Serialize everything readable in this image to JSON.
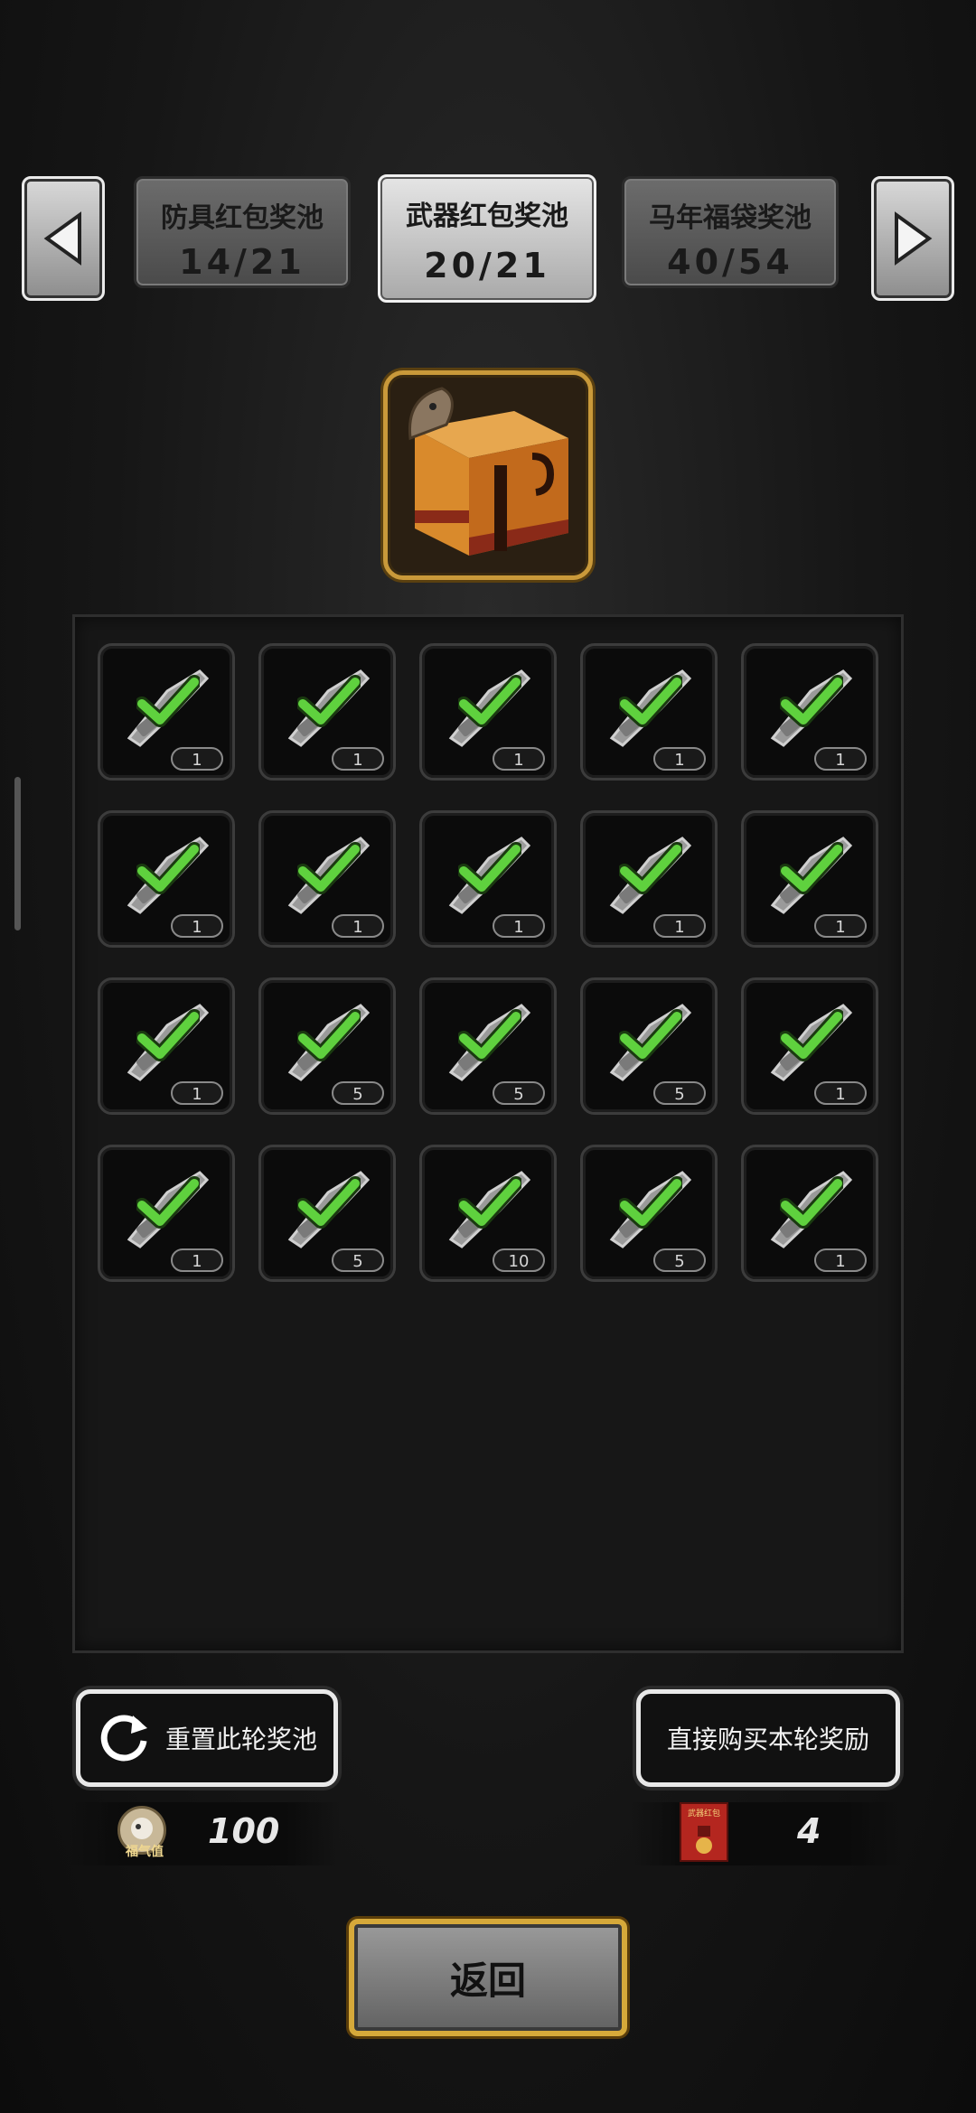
{
  "tabs": [
    {
      "label": "防具红包奖池",
      "progress": "14/21",
      "active": false
    },
    {
      "label": "武器红包奖池",
      "progress": "20/21",
      "active": true
    },
    {
      "label": "马年福袋奖池",
      "progress": "40/54",
      "active": false
    }
  ],
  "grid": [
    {
      "icon": "chainsaw-icon",
      "count": "1",
      "claimed": true
    },
    {
      "icon": "minigun-icon",
      "count": "1",
      "claimed": true
    },
    {
      "icon": "shotgun-icon",
      "count": "1",
      "claimed": true
    },
    {
      "icon": "assault-rifle-icon",
      "count": "1",
      "claimed": true
    },
    {
      "icon": "machete-icon",
      "count": "1",
      "claimed": true
    },
    {
      "icon": "knife-icon",
      "count": "1",
      "claimed": true
    },
    {
      "icon": "rifle-icon",
      "count": "1",
      "claimed": true
    },
    {
      "icon": "flamethrower-icon",
      "count": "1",
      "claimed": true
    },
    {
      "icon": "pipe-wrench-icon",
      "count": "1",
      "claimed": true
    },
    {
      "icon": "shovel-icon",
      "count": "1",
      "claimed": true
    },
    {
      "icon": "crossbow-icon",
      "count": "1",
      "claimed": true
    },
    {
      "icon": "bullets-icon",
      "count": "5",
      "claimed": true
    },
    {
      "icon": "flashbang-icon",
      "count": "5",
      "claimed": true
    },
    {
      "icon": "frag-grenade-icon",
      "count": "5",
      "claimed": true
    },
    {
      "icon": "c4-explosive-icon",
      "count": "1",
      "claimed": true
    },
    {
      "icon": "smoke-grenade-icon",
      "count": "1",
      "claimed": true
    },
    {
      "icon": "rocket-icon",
      "count": "5",
      "claimed": true
    },
    {
      "icon": "repair-kit-icon",
      "count": "10",
      "claimed": true
    },
    {
      "icon": "toolbox-icon",
      "count": "5",
      "claimed": true
    },
    {
      "icon": "rocket-launcher-icon",
      "count": "1",
      "claimed": true
    }
  ],
  "reset_button": {
    "label": "重置此轮奖池"
  },
  "buy_button": {
    "label": "直接购买本轮奖励"
  },
  "fortune": {
    "icon_label": "福气值",
    "value": "100"
  },
  "red_envelope": {
    "icon_label": "武器红包",
    "value": "4"
  },
  "back_button": {
    "label": "返回"
  }
}
